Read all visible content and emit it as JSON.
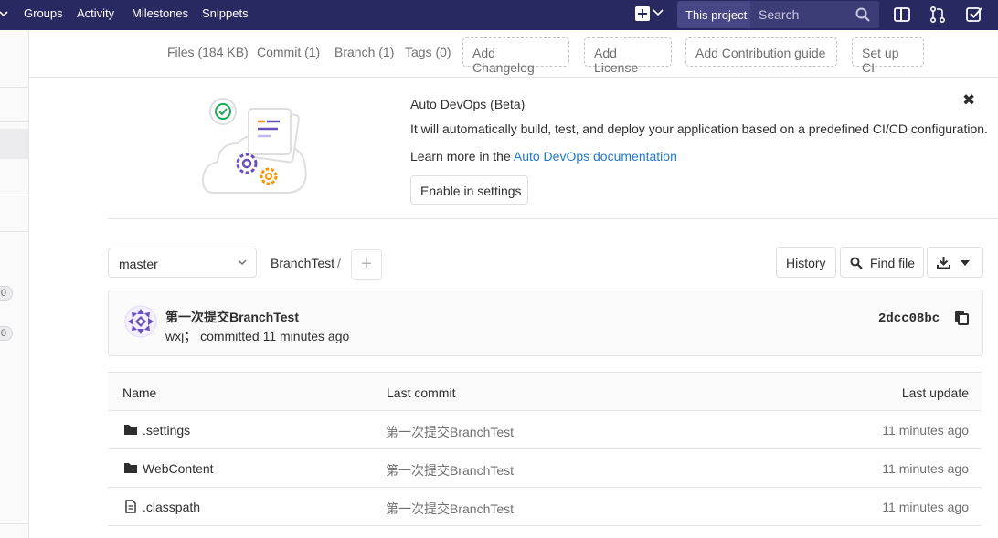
{
  "navbar": {
    "links": [
      "Groups",
      "Activity",
      "Milestones",
      "Snippets"
    ],
    "scope_label": "This project",
    "search_placeholder": "Search"
  },
  "sidebar": {
    "badges": [
      "0",
      "0"
    ]
  },
  "stats": {
    "files": "Files (184 KB)",
    "commits": "Commit (1)",
    "branches": "Branch (1)",
    "tags": "Tags (0)",
    "actions": [
      "Add Changelog",
      "Add License",
      "Add Contribution guide",
      "Set up CI"
    ]
  },
  "auto_devops": {
    "title": "Auto DevOps (Beta)",
    "description": "It will automatically build, test, and deploy your application based on a predefined CI/CD configuration.",
    "learn_prefix": "Learn more in the",
    "learn_link": "Auto DevOps documentation",
    "enable_button": "Enable in settings",
    "close_glyph": "✖"
  },
  "tree": {
    "branch": "master",
    "breadcrumb": "BranchTest",
    "separator": "/",
    "add_glyph": "+",
    "history_button": "History",
    "find_file_button": "Find file"
  },
  "commit": {
    "title": "第一次提交BranchTest",
    "author": "wxj；",
    "meta": "committed 11 minutes ago",
    "sha": "2dcc08bc"
  },
  "files": {
    "headers": [
      "Name",
      "Last commit",
      "Last update"
    ],
    "rows": [
      {
        "name": ".settings",
        "type": "folder",
        "commit": "第一次提交BranchTest",
        "updated": "11 minutes ago"
      },
      {
        "name": "WebContent",
        "type": "folder",
        "commit": "第一次提交BranchTest",
        "updated": "11 minutes ago"
      },
      {
        "name": ".classpath",
        "type": "file",
        "commit": "第一次提交BranchTest",
        "updated": "11 minutes ago"
      }
    ]
  },
  "colors": {
    "navbar": "#292961",
    "link": "#1f78d1",
    "illustration_accent": "#6b4fbb",
    "illustration_orange": "#fc9403",
    "success": "#1aaa55"
  }
}
